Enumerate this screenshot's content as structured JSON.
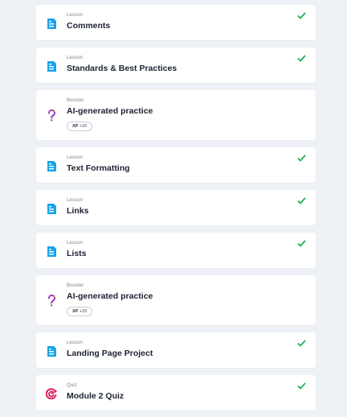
{
  "colors": {
    "background": "#eef1f5",
    "lesson_icon": "#1aa3e8",
    "booster_icon": "#9b3cc9",
    "quiz_icon": "#e01e5a",
    "check": "#1fad55"
  },
  "items": [
    {
      "type": "Lesson",
      "title": "Comments",
      "icon": "document-icon",
      "completed": true
    },
    {
      "type": "Lesson",
      "title": "Standards & Best Practices",
      "icon": "document-icon",
      "completed": true
    },
    {
      "type": "Booster",
      "title": "AI-generated practice",
      "icon": "question-mark-icon",
      "completed": false,
      "badge": {
        "label": "XP",
        "value": "+20"
      }
    },
    {
      "type": "Lesson",
      "title": "Text Formatting",
      "icon": "document-icon",
      "completed": true
    },
    {
      "type": "Lesson",
      "title": "Links",
      "icon": "document-icon",
      "completed": true
    },
    {
      "type": "Lesson",
      "title": "Lists",
      "icon": "document-icon",
      "completed": true
    },
    {
      "type": "Booster",
      "title": "AI-generated practice",
      "icon": "question-mark-icon",
      "completed": false,
      "badge": {
        "label": "XP",
        "value": "+20"
      }
    },
    {
      "type": "Lesson",
      "title": "Landing Page Project",
      "icon": "document-icon",
      "completed": true
    },
    {
      "type": "Quiz",
      "title": "Module 2 Quiz",
      "icon": "target-icon",
      "completed": true
    }
  ]
}
